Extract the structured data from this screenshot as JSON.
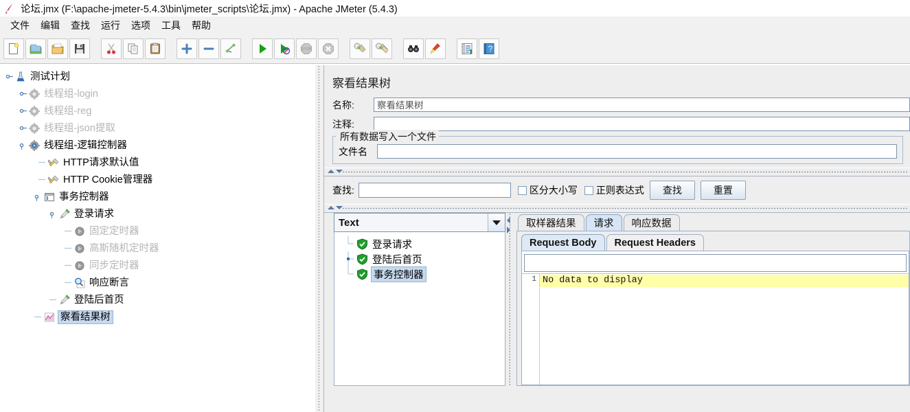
{
  "window": {
    "title": "论坛.jmx (F:\\apache-jmeter-5.4.3\\bin\\jmeter_scripts\\论坛.jmx) - Apache JMeter (5.4.3)",
    "icon": "jmeter-feather-icon"
  },
  "menubar": {
    "items": [
      {
        "label": "文件",
        "name": "menu-file"
      },
      {
        "label": "编辑",
        "name": "menu-edit"
      },
      {
        "label": "查找",
        "name": "menu-search"
      },
      {
        "label": "运行",
        "name": "menu-run"
      },
      {
        "label": "选项",
        "name": "menu-options"
      },
      {
        "label": "工具",
        "name": "menu-tools"
      },
      {
        "label": "帮助",
        "name": "menu-help"
      }
    ]
  },
  "toolbar": {
    "groups": [
      [
        "new-icon",
        "templates-icon",
        "open-icon",
        "save-icon"
      ],
      [
        "cut-icon",
        "copy-icon",
        "paste-icon"
      ],
      [
        "expand-all-icon",
        "collapse-all-icon",
        "toggle-icon"
      ],
      [
        "start-icon",
        "start-no-timers-icon",
        "stop-icon",
        "shutdown-icon"
      ],
      [
        "clear-icon",
        "clear-all-icon"
      ],
      [
        "search-icon",
        "search-reset-icon"
      ],
      [
        "function-helper-icon",
        "help-icon"
      ]
    ]
  },
  "tree": {
    "nodes": [
      {
        "label": "测试计划",
        "icon": "test-plan-icon",
        "depth": 0,
        "handle": "expanded",
        "dim": false,
        "selected": false
      },
      {
        "label": "线程组-login",
        "icon": "thread-group-icon",
        "depth": 1,
        "handle": "collapsed",
        "dim": true,
        "selected": false
      },
      {
        "label": "线程组-reg",
        "icon": "thread-group-icon",
        "depth": 1,
        "handle": "collapsed",
        "dim": true,
        "selected": false
      },
      {
        "label": "线程组-json提取",
        "icon": "thread-group-icon",
        "depth": 1,
        "handle": "collapsed",
        "dim": true,
        "selected": false
      },
      {
        "label": "线程组-逻辑控制器",
        "icon": "thread-group-active-icon",
        "depth": 1,
        "handle": "expanded",
        "dim": false,
        "selected": false
      },
      {
        "label": "HTTP请求默认值",
        "icon": "config-element-icon",
        "depth": 2,
        "handle": "leaf",
        "dim": false,
        "selected": false
      },
      {
        "label": "HTTP Cookie管理器",
        "icon": "config-element-icon",
        "depth": 2,
        "handle": "leaf",
        "dim": false,
        "selected": false
      },
      {
        "label": "事务控制器",
        "icon": "transaction-controller-icon",
        "depth": 2,
        "handle": "expanded",
        "dim": false,
        "selected": false
      },
      {
        "label": "登录请求",
        "icon": "http-sampler-icon",
        "depth": 3,
        "handle": "expanded",
        "dim": false,
        "selected": false
      },
      {
        "label": "固定定时器",
        "icon": "timer-icon",
        "depth": 4,
        "handle": "leaf",
        "dim": true,
        "selected": false
      },
      {
        "label": "高斯随机定时器",
        "icon": "timer-icon",
        "depth": 4,
        "handle": "leaf",
        "dim": true,
        "selected": false
      },
      {
        "label": "同步定时器",
        "icon": "timer-icon",
        "depth": 4,
        "handle": "leaf",
        "dim": true,
        "selected": false
      },
      {
        "label": "响应断言",
        "icon": "assertion-icon",
        "depth": 4,
        "handle": "leaf",
        "dim": false,
        "selected": false
      },
      {
        "label": "登陆后首页",
        "icon": "http-sampler-icon",
        "depth": 3,
        "handle": "leaf",
        "dim": false,
        "selected": false
      },
      {
        "label": "察看结果树",
        "icon": "view-results-tree-icon",
        "depth": 2,
        "handle": "leaf",
        "dim": false,
        "selected": true
      }
    ]
  },
  "panel": {
    "title": "察看结果树",
    "name_label": "名称:",
    "name_value": "察看结果树",
    "comment_label": "注释:",
    "comment_value": "",
    "filegroup_legend": "所有数据写入一个文件",
    "filename_label": "文件名",
    "filename_value": ""
  },
  "search": {
    "label": "查找:",
    "value": "",
    "case_sensitive_label": "区分大小写",
    "case_sensitive_checked": false,
    "regex_label": "正则表达式",
    "regex_checked": false,
    "find_button": "查找",
    "reset_button": "重置"
  },
  "results": {
    "renderer_selected": "Text",
    "nodes": [
      {
        "label": "登录请求",
        "icon": "success-shield-icon",
        "handle": "leaf",
        "selected": false
      },
      {
        "label": "登陆后首页",
        "icon": "success-shield-icon",
        "handle": "expanded",
        "selected": false
      },
      {
        "label": "事务控制器",
        "icon": "success-shield-icon",
        "handle": "leaf",
        "selected": true
      }
    ],
    "tabs": [
      {
        "label": "取样器结果",
        "active": false,
        "name": "tab-sampler-result"
      },
      {
        "label": "请求",
        "active": true,
        "name": "tab-request"
      },
      {
        "label": "响应数据",
        "active": false,
        "name": "tab-response-data"
      }
    ],
    "inner_tabs": [
      {
        "label": "Request Body",
        "active": true,
        "name": "tab-request-body"
      },
      {
        "label": "Request Headers",
        "active": false,
        "name": "tab-request-headers"
      }
    ],
    "search_field_value": "",
    "code": [
      {
        "num": "1",
        "text": "No data to display"
      }
    ]
  },
  "colors": {
    "panel_bg": "#eeeeee",
    "selection": "#c6d9ef",
    "highlight_line": "#ffffa8",
    "accent_tab": "#d6e4f4",
    "border": "#9fb0c4"
  }
}
